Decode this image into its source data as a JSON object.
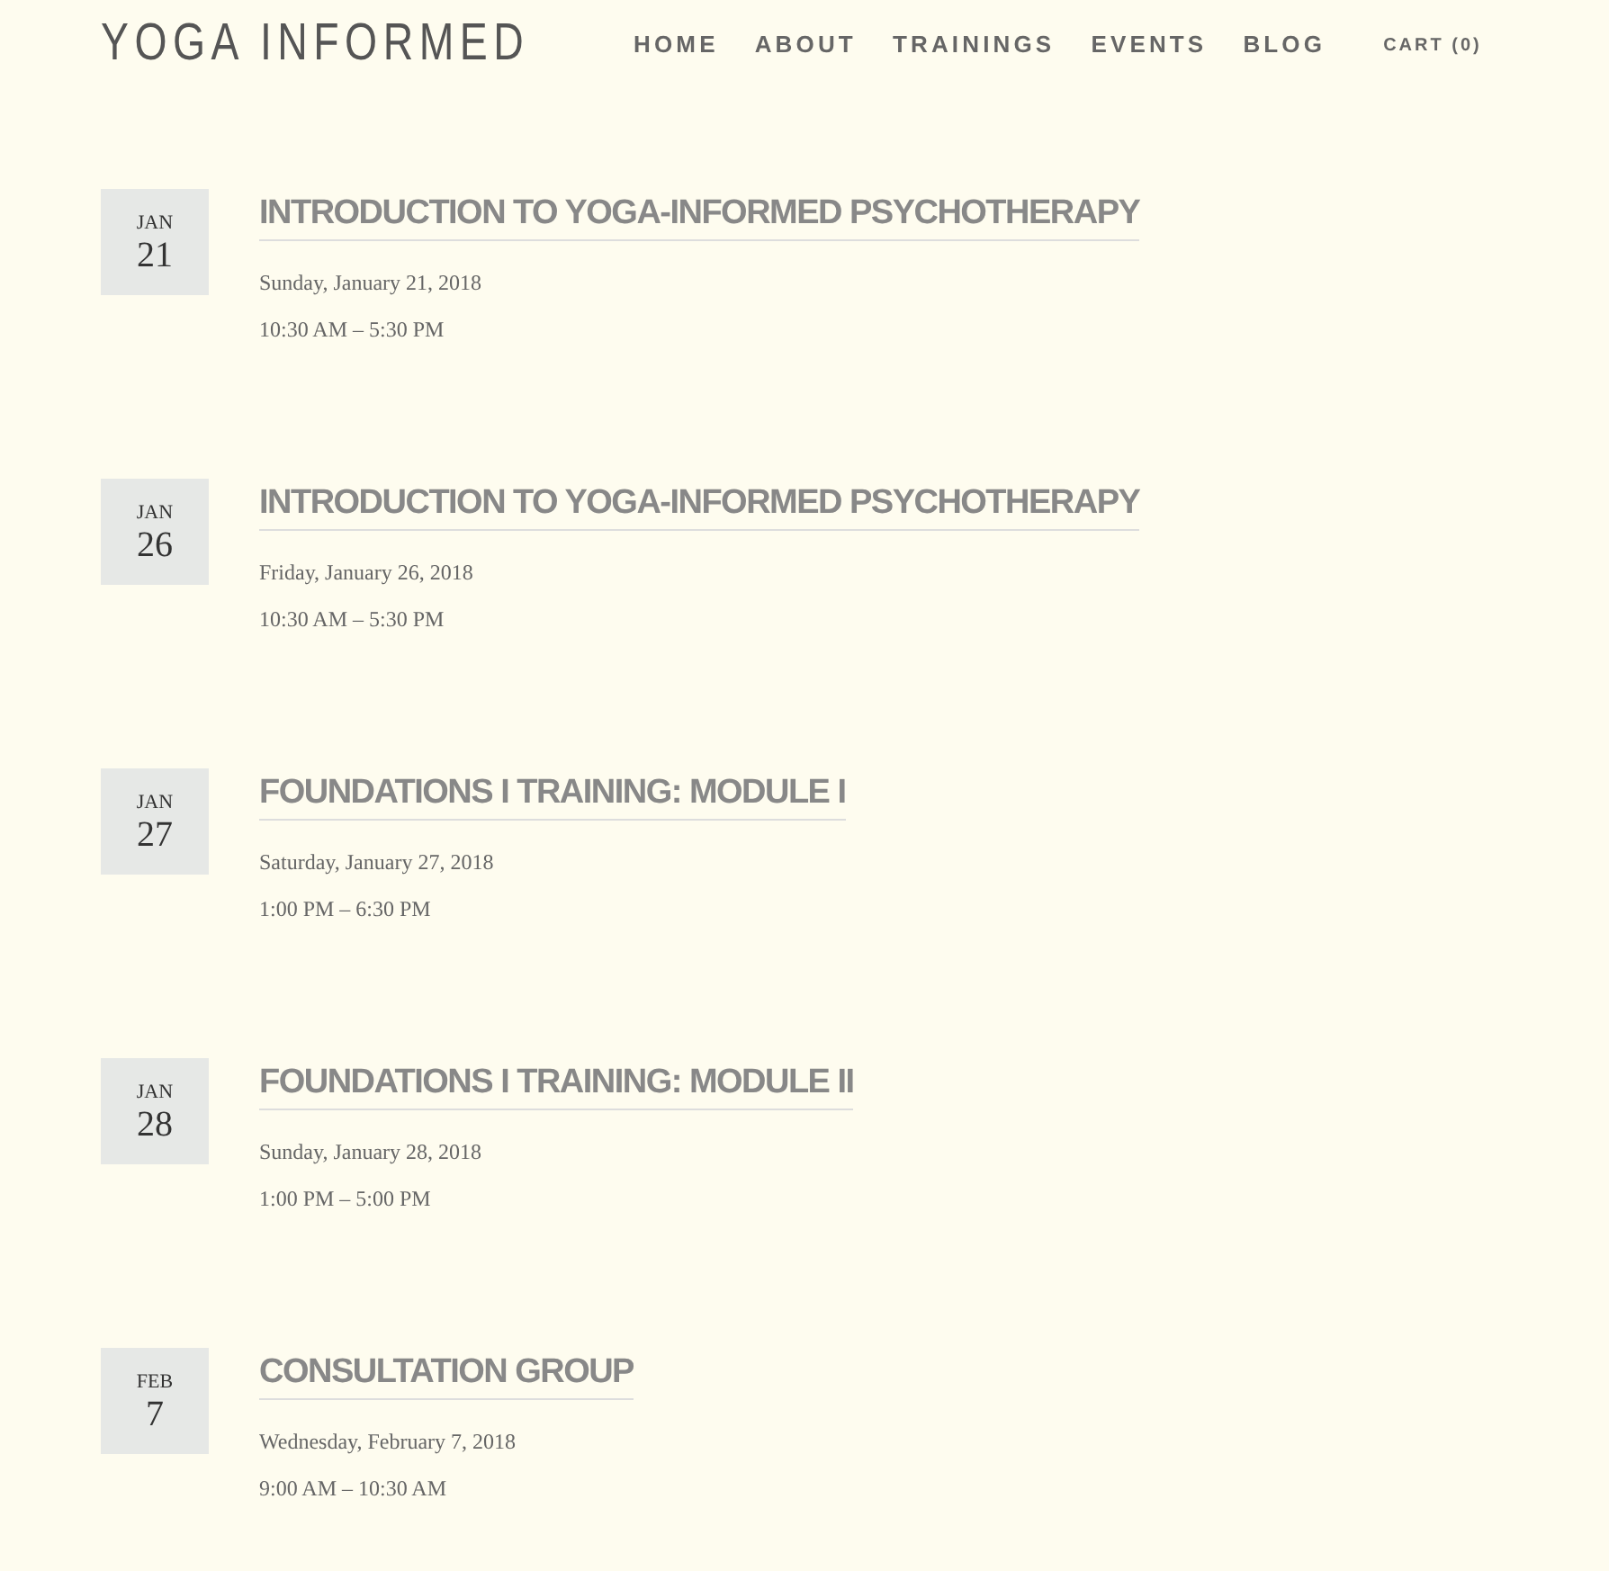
{
  "site_title": "YOGA INFORMED",
  "nav": [
    {
      "label": "HOME"
    },
    {
      "label": "ABOUT"
    },
    {
      "label": "TRAININGS"
    },
    {
      "label": "EVENTS"
    },
    {
      "label": "BLOG"
    }
  ],
  "cart": "CART (0)",
  "events": [
    {
      "month": "JAN",
      "day": "21",
      "title": "INTRODUCTION TO YOGA-INFORMED PSYCHOTHERAPY",
      "date": "Sunday, January 21, 2018",
      "time": "10:30 AM – 5:30 PM"
    },
    {
      "month": "JAN",
      "day": "26",
      "title": "INTRODUCTION TO YOGA-INFORMED PSYCHOTHERAPY",
      "date": "Friday, January 26, 2018",
      "time": "10:30 AM – 5:30 PM"
    },
    {
      "month": "JAN",
      "day": "27",
      "title": "FOUNDATIONS I TRAINING: MODULE I",
      "date": "Saturday, January 27, 2018",
      "time": "1:00 PM – 6:30 PM"
    },
    {
      "month": "JAN",
      "day": "28",
      "title": "FOUNDATIONS I TRAINING: MODULE II",
      "date": "Sunday, January 28, 2018",
      "time": "1:00 PM – 5:00 PM"
    },
    {
      "month": "FEB",
      "day": "7",
      "title": "CONSULTATION GROUP",
      "date": "Wednesday, February 7, 2018",
      "time": "9:00 AM – 10:30 AM"
    }
  ]
}
